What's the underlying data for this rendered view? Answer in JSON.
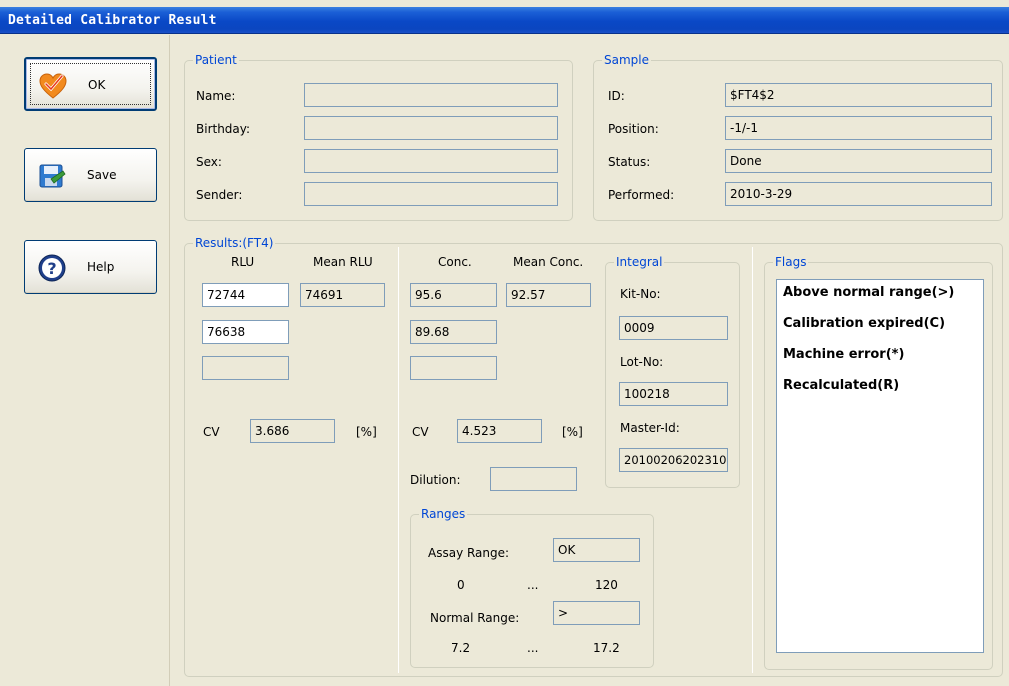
{
  "window": {
    "title": "Detailed Calibrator Result"
  },
  "buttons": {
    "ok": {
      "label": "OK"
    },
    "save": {
      "label": "Save"
    },
    "help": {
      "label": "Help"
    }
  },
  "patient": {
    "legend": "Patient",
    "fields": [
      {
        "label": "Name:",
        "value": ""
      },
      {
        "label": "Birthday:",
        "value": ""
      },
      {
        "label": "Sex:",
        "value": ""
      },
      {
        "label": "Sender:",
        "value": ""
      }
    ]
  },
  "sample": {
    "legend": "Sample",
    "fields": [
      {
        "label": "ID:",
        "value": "$FT4$2"
      },
      {
        "label": "Position:",
        "value": "-1/-1"
      },
      {
        "label": "Status:",
        "value": "Done"
      },
      {
        "label": "Performed:",
        "value": "2010-3-29"
      }
    ]
  },
  "results": {
    "legend": "Results:(FT4)",
    "rlu_header": "RLU",
    "mean_rlu_header": "Mean RLU",
    "rlu_values": [
      "72744",
      "76638",
      ""
    ],
    "mean_rlu": "74691",
    "cv_label": "CV",
    "cv_rlu": "3.686",
    "percent": "[%]",
    "conc_header": "Conc.",
    "mean_conc_header": "Mean Conc.",
    "conc_values": [
      "95.6",
      "89.68",
      ""
    ],
    "mean_conc": "92.57",
    "cv_conc": "4.523",
    "dilution_label": "Dilution:",
    "dilution_value": ""
  },
  "integral": {
    "legend": "Integral",
    "kit_no_label": "Kit-No:",
    "kit_no": "0009",
    "lot_no_label": "Lot-No:",
    "lot_no": "100218",
    "master_id_label": "Master-Id:",
    "master_id": "20100206202310"
  },
  "ranges": {
    "legend": "Ranges",
    "assay_label": "Assay Range:",
    "assay_value": "OK",
    "assay_low": "0",
    "assay_dots": "...",
    "assay_high": "120",
    "normal_label": "Normal Range:",
    "normal_value": ">",
    "normal_low": "7.2",
    "normal_dots": "...",
    "normal_high": "17.2"
  },
  "flags": {
    "legend": "Flags",
    "items": [
      "Above normal range(>)",
      "Calibration expired(C)",
      "Machine error(*)",
      "Recalculated(R)"
    ]
  },
  "colors": {
    "title_bar": "#0a48c6",
    "legend_text": "#0046d5",
    "window_bg": "#ece9d8"
  }
}
